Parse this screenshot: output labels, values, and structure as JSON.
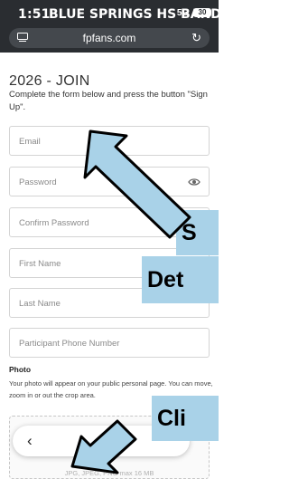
{
  "status_bar": {
    "time": "1:51",
    "overlay_title": "BLUE SPRINGS HS BAND",
    "network": "5G",
    "battery": "30"
  },
  "browser": {
    "url": "fpfans.com"
  },
  "form": {
    "title": "2026 - JOIN",
    "instructions": "Complete the form below and press the button \"Sign Up\".",
    "fields": {
      "email": "Email",
      "password": "Password",
      "confirm_password": "Confirm Password",
      "first_name": "First Name",
      "last_name": "Last Name",
      "phone": "Participant Phone Number"
    },
    "photo": {
      "label": "Photo",
      "help": "Your photo will appear on your public personal page. You can move, zoom in or out the crop area.",
      "dropzone_hint": "JPG, JPEG, PNG max 16 MB"
    }
  },
  "annotations": {
    "callout_1": "S",
    "callout_2": "Det",
    "callout_3": "Cli"
  },
  "colors": {
    "header_bg": "#2a2d31",
    "callout_bg": "#a9d2e8",
    "arrow_fill": "#a9d2e8"
  }
}
